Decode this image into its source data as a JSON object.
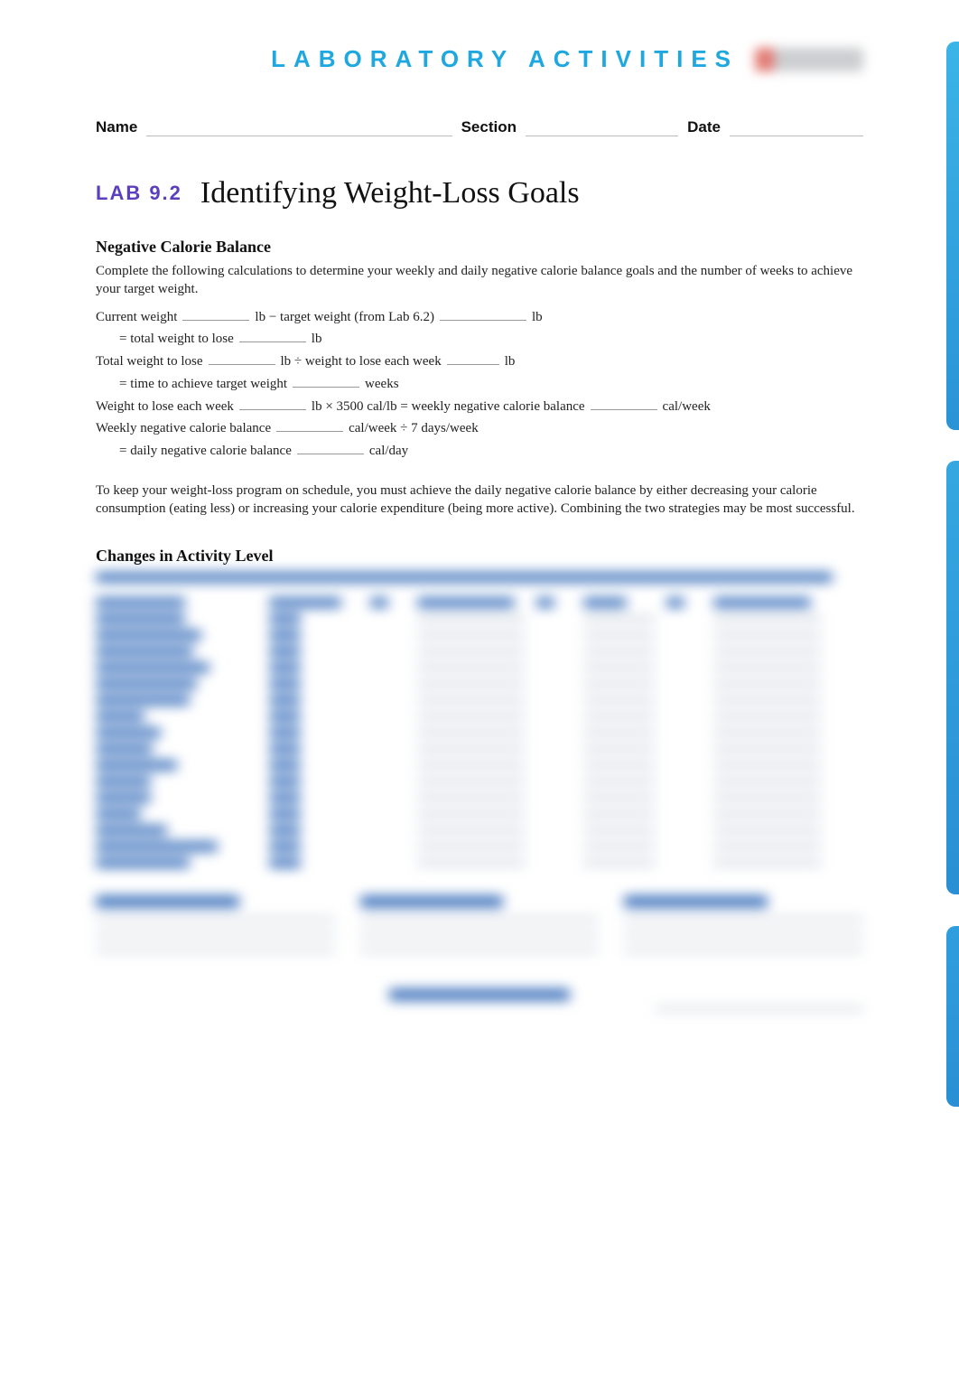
{
  "header": {
    "title": "LABORATORY ACTIVITIES"
  },
  "info": {
    "nameLabel": "Name",
    "sectionLabel": "Section",
    "dateLabel": "Date"
  },
  "lab": {
    "number": "LAB 9.2",
    "title": "Identifying Weight-Loss Goals"
  },
  "section1": {
    "heading": "Negative Calorie Balance",
    "intro": "Complete the following calculations to determine your weekly and daily negative calorie balance goals and the number of weeks to achieve your target weight.",
    "l1a": "Current weight",
    "l1b": "lb − target weight (from Lab 6.2)",
    "l1c": "lb",
    "l1d": "= total weight to lose",
    "l1e": "lb",
    "l2a": "Total weight to lose",
    "l2b": "lb ÷ weight to lose each week",
    "l2c": "lb",
    "l2d": "= time to achieve target weight",
    "l2e": "weeks",
    "l3a": "Weight to lose each week",
    "l3b": "lb × 3500 cal/lb = weekly negative calorie balance",
    "l3c": "cal/week",
    "l4a": "Weekly negative calorie balance",
    "l4b": "cal/week ÷ 7 days/week",
    "l4c": "= daily negative calorie balance",
    "l4d": "cal/day",
    "outro": "To keep your weight-loss program on schedule, you must achieve the daily negative calorie balance by either decreasing your calorie consumption (eating less) or increasing your calorie expenditure (being more active). Combining the two strategies may be most successful."
  },
  "section2": {
    "heading": "Changes in Activity Level"
  }
}
